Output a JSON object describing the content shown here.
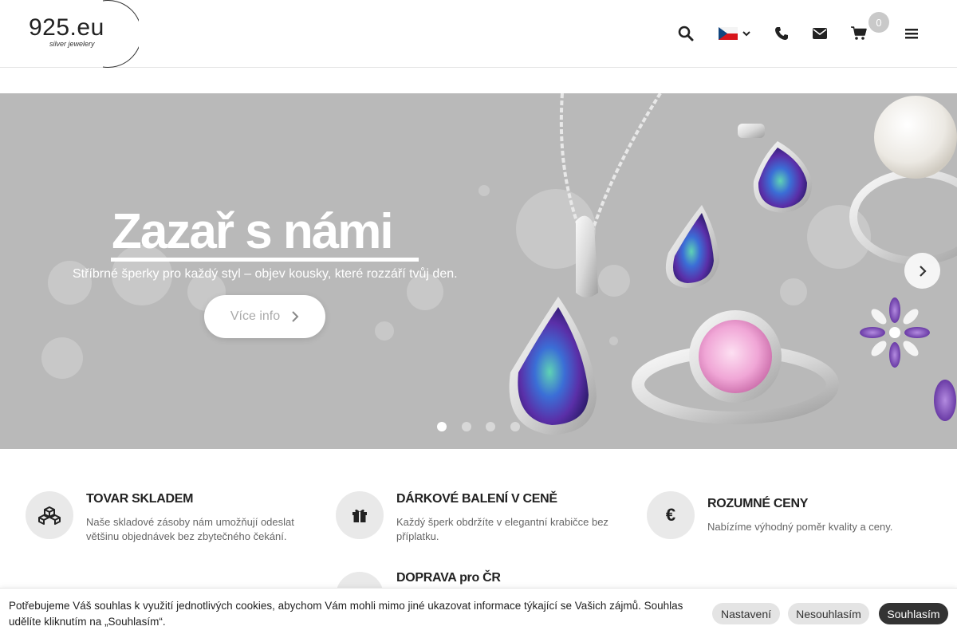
{
  "header": {
    "logo_text": "925.eu",
    "logo_sub": "silver jewelery",
    "cart_count": "0",
    "icons": [
      "search-icon",
      "flag-cz-icon",
      "chevron-down-icon",
      "phone-icon",
      "envelope-icon",
      "cart-icon",
      "hamburger-icon"
    ]
  },
  "hero": {
    "title": "Zazař s námi",
    "subtitle": "Stříbrné šperky pro každý styl – objev kousky, které rozzáří tvůj den.",
    "button_label": "Více info",
    "slides_count": 4,
    "active_slide": 1
  },
  "features": [
    {
      "title": "TOVAR SKLADEM",
      "text": "Naše skladové zásoby nám umožňují odeslat většinu objednávek bez zbytečného čekání.",
      "icon": "boxes-icon"
    },
    {
      "title": "DÁRKOVÉ BALENÍ V CENĚ",
      "text": "Každý šperk obdržíte v elegantní krabičce bez příplatku.",
      "icon": "gift-icon"
    },
    {
      "title": "ROZUMNÉ CENY",
      "text": "Nabízíme výhodný poměr kvality a ceny.",
      "icon": "euro-icon",
      "icon_glyph": "€"
    },
    {
      "title": "DOPRAVA pro ČR",
      "text": "",
      "icon": "truck-icon"
    }
  ],
  "cookie": {
    "text": "Potřebujeme Váš souhlas k využití jednotlivých cookies, abychom Vám mohli mimo jiné ukazovat informace týkající se Vašich zájmů. Souhlas udělíte kliknutím na „Souhlasím“.",
    "settings_label": "Nastavení",
    "decline_label": "Nesouhlasím",
    "accept_label": "Souhlasím"
  },
  "colors": {
    "hero_bg": "#b9b9b9",
    "feature_circle": "#e9e9e9",
    "accept_button": "#333333",
    "badge": "#c9c9c9"
  }
}
